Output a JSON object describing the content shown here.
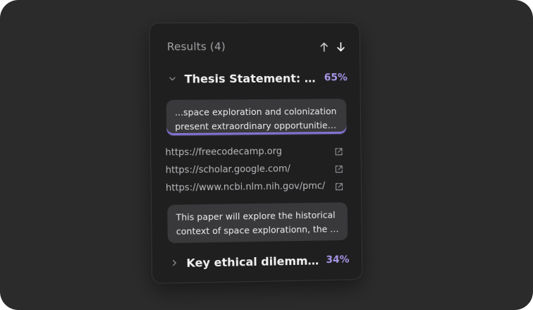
{
  "results": {
    "title": "Results (4)"
  },
  "groups": [
    {
      "title": "Thesis Statement: Space exploration and colonization",
      "percent": "65%",
      "expanded": true,
      "snippets": [
        {
          "lines": [
            "...space exploration and colonization",
            "present extraordinary opportunities for humanity"
          ],
          "active": true
        },
        {
          "lines": [
            "This paper will explore the historical",
            "context of space explorationn, the ethical implications"
          ],
          "active": false
        }
      ],
      "sources": [
        "https://freecodecamp.org",
        "https://scholar.google.com/",
        "https://www.ncbi.nlm.nih.gov/pmc/"
      ]
    },
    {
      "title": "Key ethical dilemmas and considerations",
      "percent": "34%",
      "expanded": false
    }
  ],
  "icons": {
    "sort_up": "arrow-up-icon",
    "sort_down": "arrow-down-icon",
    "expand": "chevron-down-icon",
    "collapse": "chevron-right-icon",
    "open_link": "external-link-icon"
  },
  "colors": {
    "background": "#2b2b2b",
    "panel": "#1f1f20",
    "card": "#39393b",
    "accent": "#a895e6"
  }
}
